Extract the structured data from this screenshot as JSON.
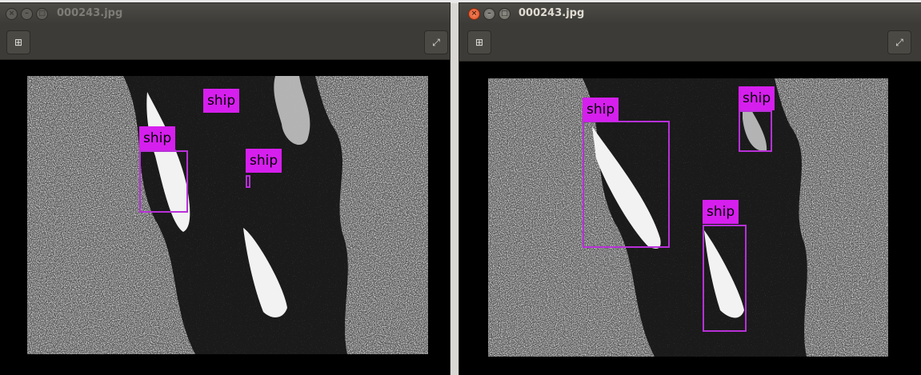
{
  "windows": [
    {
      "id": "left",
      "title": "000243.jpg",
      "focused": false,
      "labels": [
        "ship",
        "ship",
        "ship"
      ]
    },
    {
      "id": "right",
      "title": "000243.jpg",
      "focused": true,
      "labels": [
        "ship",
        "ship",
        "ship"
      ]
    }
  ],
  "icons": {
    "close": "close-icon",
    "minimize": "minimize-icon",
    "maximize": "maximize-icon",
    "zoom": "zoom-fit-icon",
    "fullscreen": "fullscreen-icon"
  },
  "colors": {
    "detection_box": "#b830d8",
    "label_bg": "#d61fee"
  }
}
